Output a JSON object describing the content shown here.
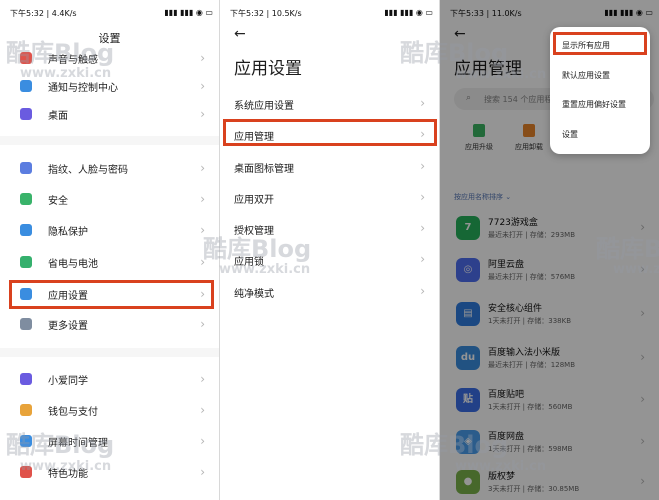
{
  "panel1": {
    "status": {
      "time": "下午5:32 | 4.4K/s",
      "icons": "▮▮▮ ▮▮▮ ◉ ▭"
    },
    "title": "设置",
    "items": [
      {
        "label": "声音与触感",
        "icon": "sound-icon",
        "color": "#e0524a"
      },
      {
        "label": "通知与控制中心",
        "icon": "notification-icon",
        "color": "#3a8de0"
      },
      {
        "label": "桌面",
        "icon": "home-icon",
        "color": "#6a5be0"
      },
      {
        "label": "指纹、人脸与密码",
        "icon": "fingerprint-icon",
        "color": "#5b7de0"
      },
      {
        "label": "安全",
        "icon": "shield-icon",
        "color": "#39b36a"
      },
      {
        "label": "隐私保护",
        "icon": "privacy-icon",
        "color": "#3a8de0"
      },
      {
        "label": "省电与电池",
        "icon": "battery-icon",
        "color": "#35b06d"
      },
      {
        "label": "应用设置",
        "icon": "gear-icon",
        "color": "#3a8de0"
      },
      {
        "label": "更多设置",
        "icon": "more-icon",
        "color": "#7f8da0"
      },
      {
        "label": "小爱同学",
        "icon": "assistant-icon",
        "color": "#6a5be0"
      },
      {
        "label": "钱包与支付",
        "icon": "wallet-icon",
        "color": "#e8a33a"
      },
      {
        "label": "屏幕时间管理",
        "icon": "hourglass-icon",
        "color": "#3a8de0"
      },
      {
        "label": "特色功能",
        "icon": "feature-icon",
        "color": "#e0524a"
      }
    ]
  },
  "panel2": {
    "status": {
      "time": "下午5:32 | 10.5K/s",
      "icons": "▮▮▮ ▮▮▮ ◉ ▭"
    },
    "title": "应用设置",
    "items": [
      {
        "label": "系统应用设置"
      },
      {
        "label": "应用管理"
      },
      {
        "label": "桌面图标管理"
      },
      {
        "label": "应用双开"
      },
      {
        "label": "授权管理"
      },
      {
        "label": "应用锁"
      },
      {
        "label": "纯净模式"
      }
    ]
  },
  "panel3": {
    "status": {
      "time": "下午5:33 | 11.0K/s",
      "icons": "▮▮▮ ▮▮▮ ◉ ▭"
    },
    "title": "应用管理",
    "search_placeholder": "搜索 154 个应用程",
    "tools": [
      {
        "label": "应用升级",
        "icon": "upgrade-icon",
        "color": "#3cb563"
      },
      {
        "label": "应用卸载",
        "icon": "trash-icon",
        "color": "#e8862a"
      }
    ],
    "sort_label": "按应用名称排序 ⌄",
    "apps": [
      {
        "name": "7723游戏盒",
        "sub": "最近未打开 | 存储：293MB",
        "glyph": "7",
        "color": "#26b15c"
      },
      {
        "name": "阿里云盘",
        "sub": "最近未打开 | 存储：576MB",
        "glyph": "◎",
        "color": "#4f6ef2"
      },
      {
        "name": "安全核心组件",
        "sub": "1天未打开 | 存储：338KB",
        "glyph": "▤",
        "color": "#2f7de0"
      },
      {
        "name": "百度输入法小米版",
        "sub": "最近未打开 | 存储：128MB",
        "glyph": "du",
        "color": "#3a8de0"
      },
      {
        "name": "百度贴吧",
        "sub": "1天未打开 | 存储：560MB",
        "glyph": "贴",
        "color": "#3b6fe8"
      },
      {
        "name": "百度网盘",
        "sub": "1天未打开 | 存储：598MB",
        "glyph": "◈",
        "color": "#4a9ff0"
      },
      {
        "name": "版权梦",
        "sub": "3天未打开 | 存储：30.85MB",
        "glyph": "●",
        "color": "#7bb34a"
      }
    ],
    "popup": {
      "items": [
        {
          "label": "显示所有应用"
        },
        {
          "label": "默认应用设置"
        },
        {
          "label": "重置应用偏好设置"
        },
        {
          "label": "设置"
        }
      ]
    }
  },
  "accent_color": "#d9411e",
  "watermark": {
    "brand": "酷库Blog",
    "url": "www.zxki.cn"
  }
}
